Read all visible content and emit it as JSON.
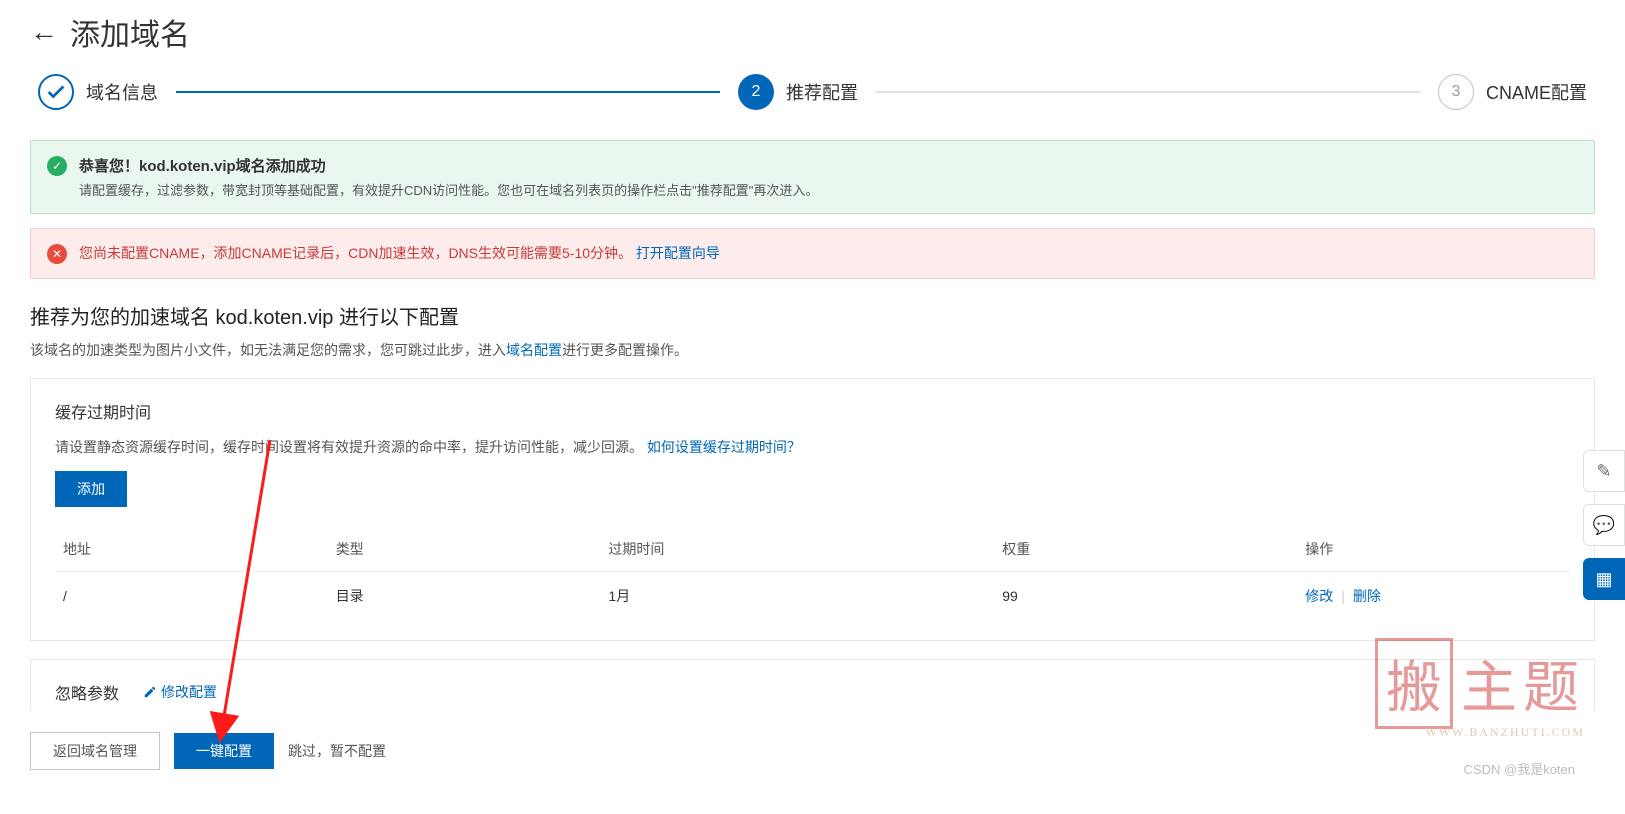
{
  "header": {
    "title": "添加域名"
  },
  "stepper": {
    "steps": [
      {
        "label": "域名信息"
      },
      {
        "label": "推荐配置",
        "num": "2"
      },
      {
        "label": "CNAME配置",
        "num": "3"
      }
    ]
  },
  "alerts": {
    "success": {
      "title": "恭喜您！kod.koten.vip域名添加成功",
      "desc": "请配置缓存，过滤参数，带宽封顶等基础配置，有效提升CDN访问性能。您也可在域名列表页的操作栏点击\"推荐配置\"再次进入。"
    },
    "error": {
      "text": "您尚未配置CNAME，添加CNAME记录后，CDN加速生效，DNS生效可能需要5-10分钟。",
      "link": "打开配置向导"
    }
  },
  "recommend": {
    "heading": "推荐为您的加速域名 kod.koten.vip 进行以下配置",
    "sub_pre": "该域名的加速类型为图片小文件，如无法满足您的需求，您可跳过此步，进入",
    "sub_link": "域名配置",
    "sub_post": "进行更多配置操作。"
  },
  "cache_card": {
    "title": "缓存过期时间",
    "desc": "请设置静态资源缓存时间，缓存时间设置将有效提升资源的命中率，提升访问性能，减少回源。 ",
    "help_link": "如何设置缓存过期时间？",
    "add_btn": "添加",
    "columns": {
      "addr": "地址",
      "type": "类型",
      "expire": "过期时间",
      "weight": "权重",
      "ops": "操作"
    },
    "row": {
      "addr": "/",
      "type": "目录",
      "expire": "1月",
      "weight": "99",
      "edit": "修改",
      "del": "删除"
    }
  },
  "param_card": {
    "title": "忽略参数",
    "edit": "修改配置"
  },
  "footer": {
    "back": "返回域名管理",
    "apply": "一键配置",
    "skip": "跳过，暂不配置"
  },
  "watermark": {
    "stamp": "搬",
    "text": "主题",
    "sub": "WWW.BANZHUTI.COM"
  },
  "csdn": "CSDN @我是koten"
}
